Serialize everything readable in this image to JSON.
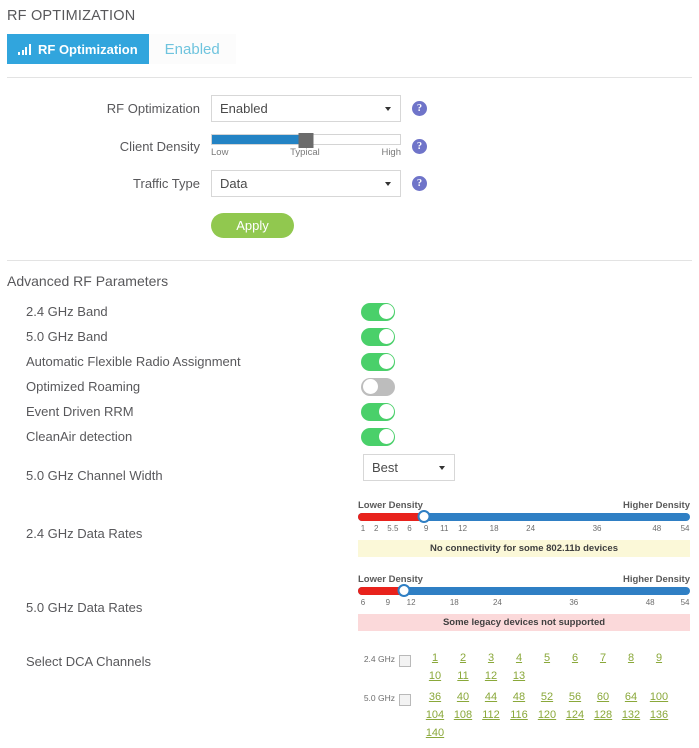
{
  "page": {
    "title": "RF OPTIMIZATION"
  },
  "tabs": {
    "active_label": "RF Optimization",
    "active_icon": "signal-bars-icon",
    "value_label": "Enabled"
  },
  "form": {
    "rf_optimization": {
      "label": "RF Optimization",
      "value": "Enabled",
      "help": "?"
    },
    "client_density": {
      "label": "Client Density",
      "low_label": "Low",
      "mid_label": "Typical",
      "high_label": "High",
      "value_percent": 50,
      "help": "?"
    },
    "traffic_type": {
      "label": "Traffic Type",
      "value": "Data",
      "help": "?"
    },
    "apply_label": "Apply"
  },
  "advanced": {
    "title": "Advanced RF Parameters",
    "toggles": [
      {
        "label": "2.4 GHz Band",
        "state": "on"
      },
      {
        "label": "5.0 GHz Band",
        "state": "on"
      },
      {
        "label": "Automatic Flexible Radio Assignment",
        "state": "on"
      },
      {
        "label": "Optimized Roaming",
        "state": "off"
      },
      {
        "label": "Event Driven RRM",
        "state": "on"
      },
      {
        "label": "CleanAir detection",
        "state": "on"
      }
    ],
    "channel_width": {
      "label": "5.0 GHz Channel Width",
      "value": "Best"
    },
    "rates_24": {
      "label": "2.4 GHz Data Rates",
      "lower_label": "Lower Density",
      "higher_label": "Higher Density",
      "ticks": [
        "1",
        "2",
        "5.5",
        "6",
        "9",
        "11",
        "12",
        "18",
        "24",
        "36",
        "48",
        "54"
      ],
      "tick_positions": [
        1.5,
        5.5,
        10.5,
        15.5,
        20.5,
        26,
        31.5,
        41,
        52,
        72,
        90,
        98.5
      ],
      "thumb_percent": 20,
      "warning": "No connectivity for some 802.11b devices"
    },
    "rates_50": {
      "label": "5.0 GHz Data Rates",
      "lower_label": "Lower Density",
      "higher_label": "Higher Density",
      "ticks": [
        "6",
        "9",
        "12",
        "18",
        "24",
        "36",
        "48",
        "54"
      ],
      "tick_positions": [
        1.5,
        9,
        16,
        29,
        42,
        65,
        88,
        98.5
      ],
      "thumb_percent": 14,
      "warning": "Some legacy devices not supported"
    },
    "dca": {
      "label": "Select DCA Channels",
      "band_24_label": "2.4 GHz",
      "band_50_label": "5.0 GHz",
      "channels_24": [
        "1",
        "2",
        "3",
        "4",
        "5",
        "6",
        "7",
        "8",
        "9",
        "10",
        "11",
        "12",
        "13"
      ],
      "channels_50": [
        "36",
        "40",
        "44",
        "48",
        "52",
        "56",
        "60",
        "64",
        "100",
        "104",
        "108",
        "112",
        "116",
        "120",
        "124",
        "128",
        "132",
        "136",
        "140"
      ]
    }
  },
  "colors": {
    "tab_active": "#31a5dd",
    "tab_value_text": "#6fc4de",
    "apply_green": "#91c84f",
    "toggle_on": "#4ad06a",
    "toggle_off": "#bdbdbd",
    "slider_blue": "#2f7fc4",
    "slider_red": "#e8221c",
    "channel_green": "#8aa83a",
    "help_purple": "#6f74c9"
  }
}
